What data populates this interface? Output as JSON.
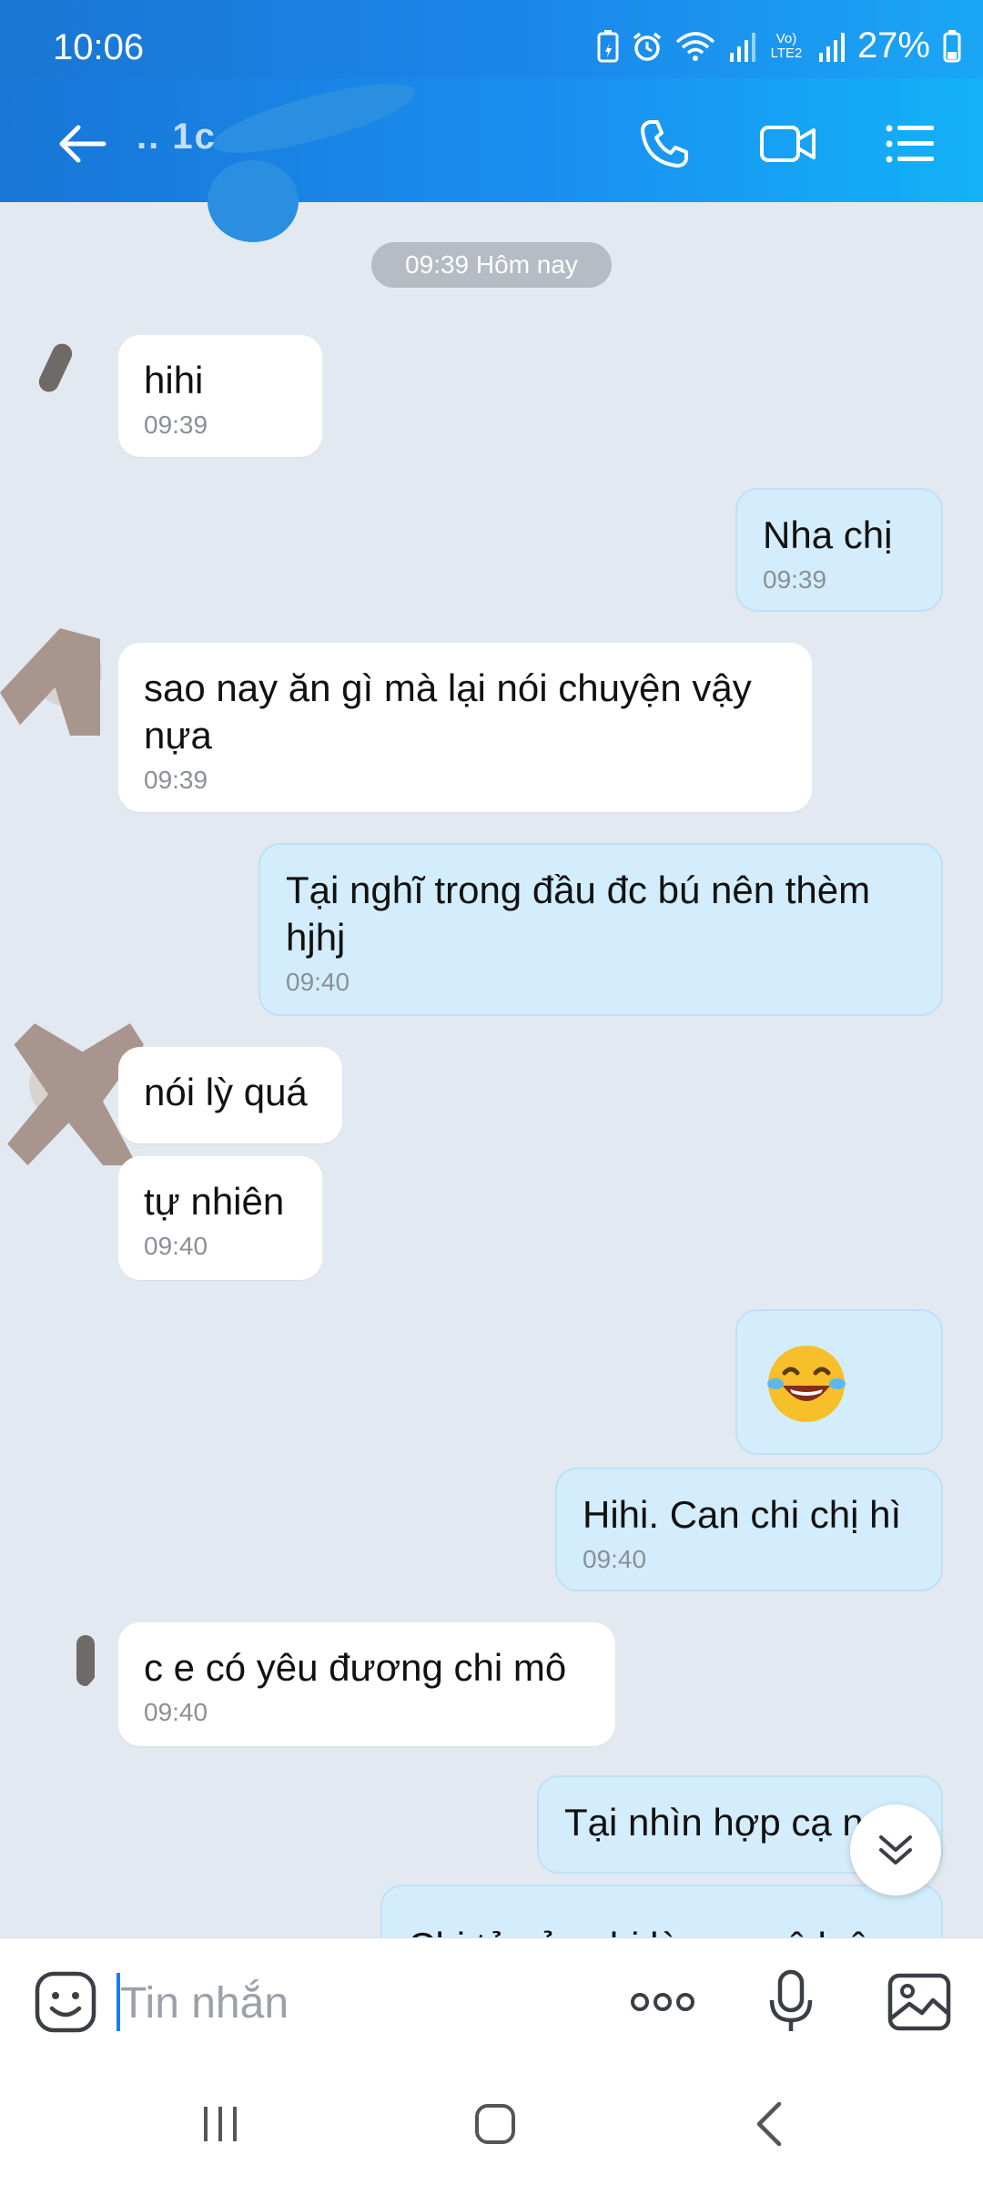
{
  "status_bar": {
    "time": "10:06",
    "network_label": "Vo) LTE2",
    "battery": "27%"
  },
  "header": {
    "contact_name": "  ..    1c",
    "icons": [
      "back-arrow-icon",
      "phone-icon",
      "video-camera-icon",
      "list-menu-icon"
    ]
  },
  "chat": {
    "date_separator": "09:39 Hôm nay",
    "messages": [
      {
        "side": "in",
        "text": "hihi",
        "time": "09:39"
      },
      {
        "side": "out",
        "text": "Nha chị",
        "time": "09:39"
      },
      {
        "side": "in",
        "text": "sao nay ăn gì mà lại nói chuyện vậy nựa",
        "time": "09:39"
      },
      {
        "side": "out",
        "text": "Tại nghĩ trong đầu đc bú nên thèm hjhj",
        "time": "09:40"
      },
      {
        "side": "in",
        "text": "nói lỳ quá",
        "time": ""
      },
      {
        "side": "in",
        "text": "tự nhiên",
        "time": "09:40"
      },
      {
        "side": "out",
        "text": "",
        "time": "",
        "sticker": "laughing-tears-emoji"
      },
      {
        "side": "out",
        "text": "Hihi. Can chi chị hì",
        "time": "09:40"
      },
      {
        "side": "in",
        "text": "c e có yêu đương chi mô",
        "time": "09:40"
      },
      {
        "side": "out",
        "text": "Tại nhìn hợp cạ n",
        "time": ""
      },
      {
        "side": "out",
        "text": "Chị tả của chị làm e mê luôn",
        "time": ""
      }
    ]
  },
  "composer": {
    "placeholder": "Tin nhắn",
    "icons": [
      "sticker-icon",
      "more-dots-icon",
      "microphone-icon",
      "image-icon"
    ]
  },
  "colors": {
    "header_start": "#1876d6",
    "header_end": "#13b2f7",
    "chat_background": "#e2e9f1",
    "outgoing_bubble": "#d3edfc",
    "incoming_bubble": "#ffffff",
    "accent": "#1a7cf0"
  }
}
